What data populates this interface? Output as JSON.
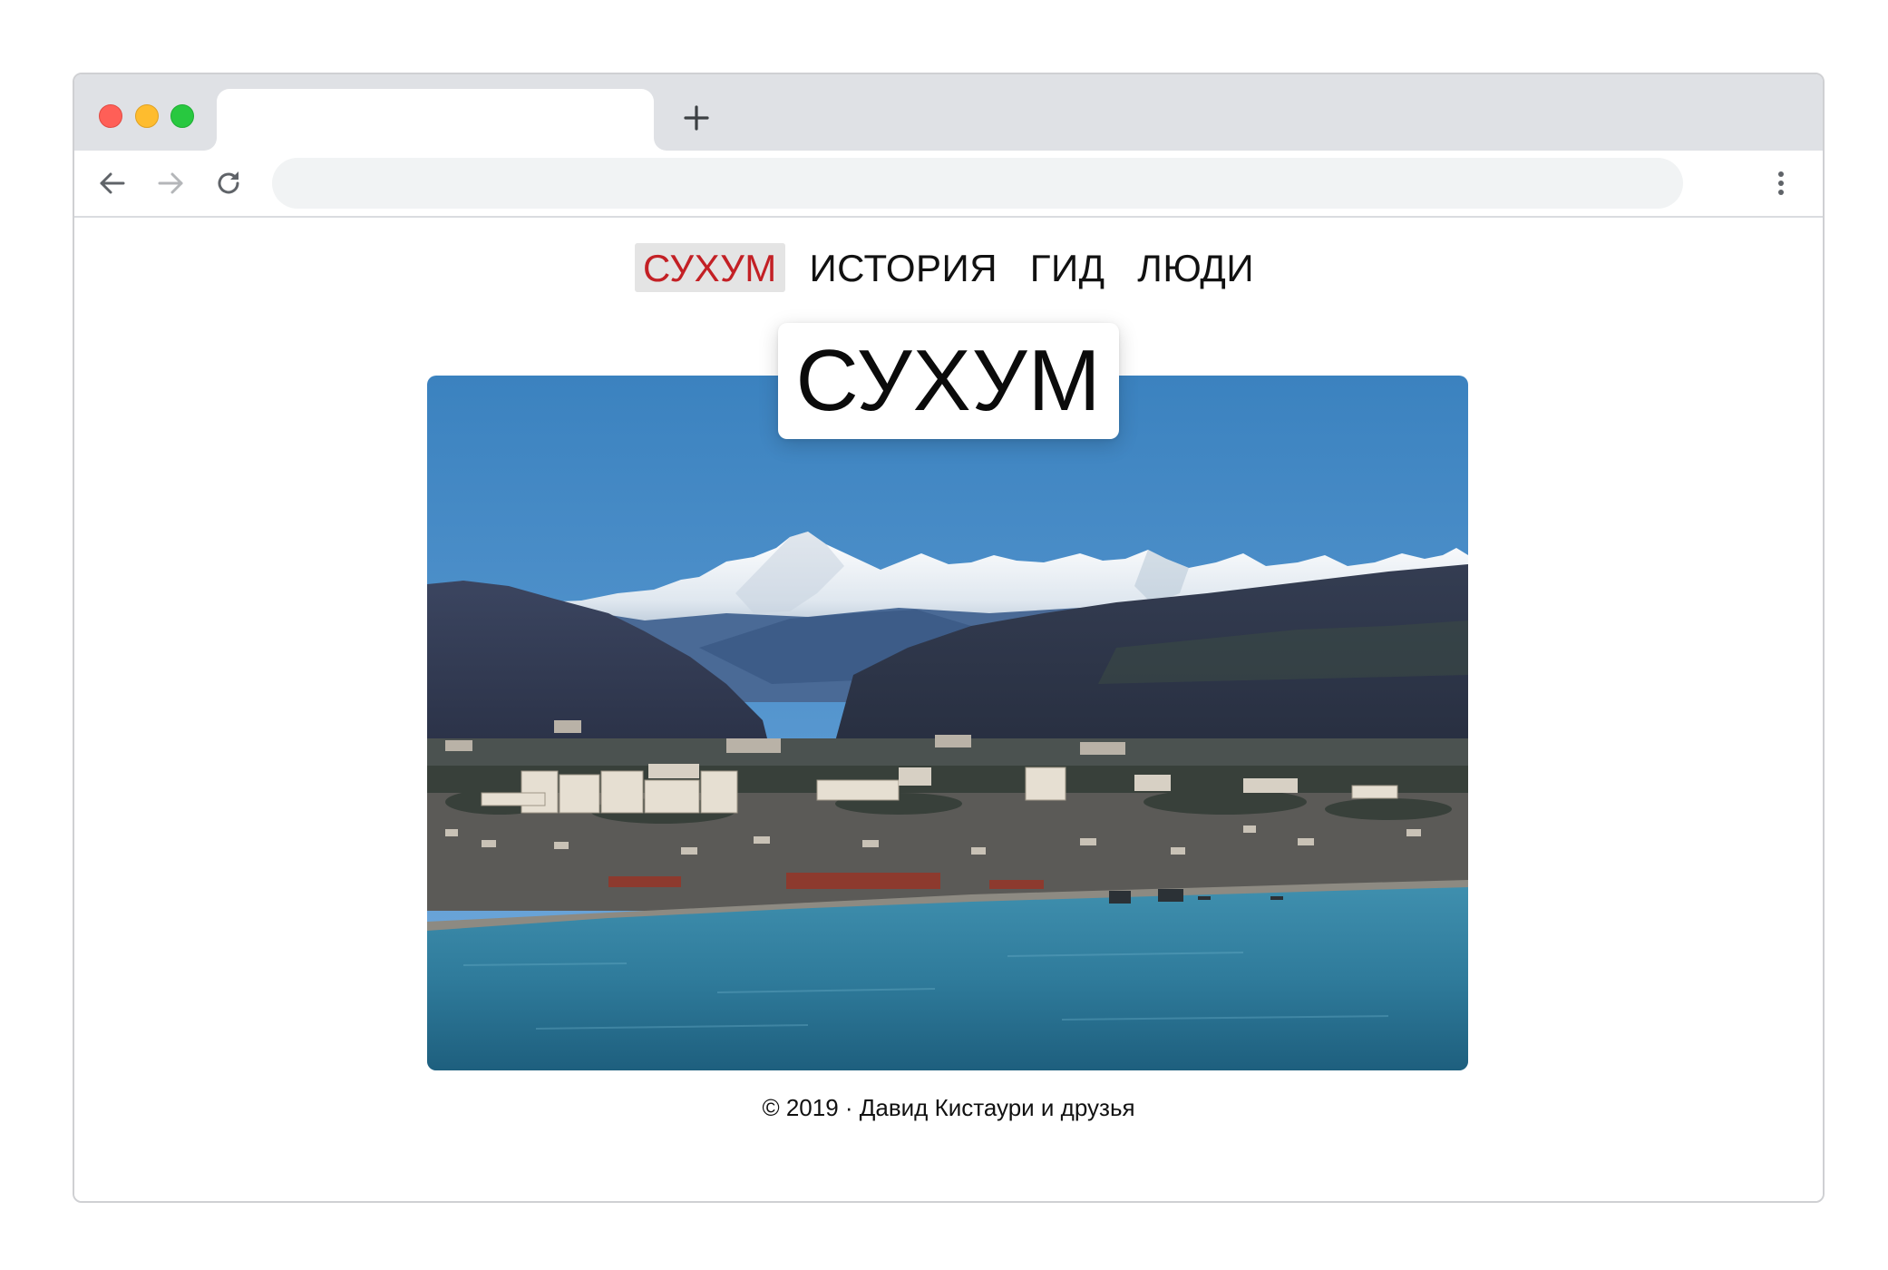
{
  "browser": {
    "tab_title": "",
    "new_tab_label": "+",
    "address": "",
    "icons": {
      "back": "arrow-left-icon",
      "forward": "arrow-right-icon",
      "reload": "reload-icon",
      "menu": "kebab-menu-icon",
      "new_tab": "plus-icon"
    }
  },
  "site": {
    "nav": [
      {
        "label": "СУХУМ",
        "active": true
      },
      {
        "label": "ИСТОРИЯ",
        "active": false
      },
      {
        "label": "ГИД",
        "active": false
      },
      {
        "label": "ЛЮДИ",
        "active": false
      }
    ],
    "title": "СУХУМ",
    "footer": "© 2019 · Давид Кистаури и друзья",
    "colors": {
      "active_nav_text": "#c32025",
      "active_nav_bg": "#e4e4e4",
      "text": "#111111"
    }
  }
}
